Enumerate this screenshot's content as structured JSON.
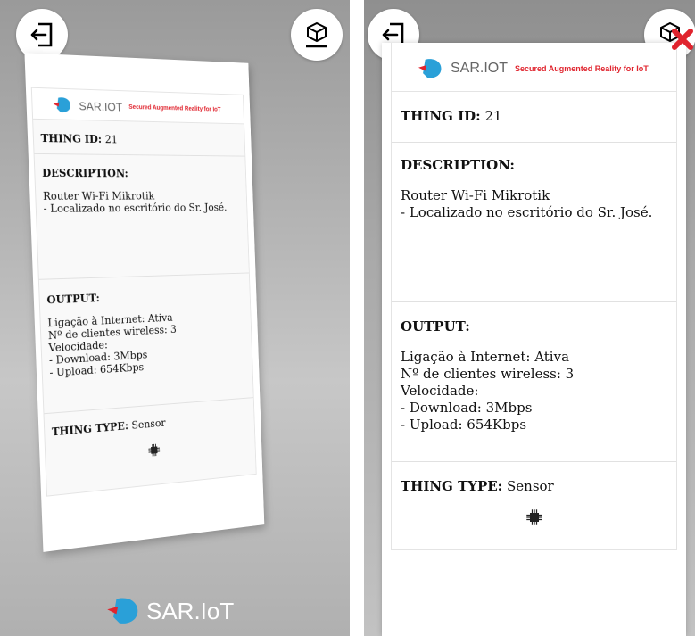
{
  "brand": {
    "name": "SAR.IOT",
    "tagline": "Secured Augmented Reality for IoT",
    "bottom_name": "SAR.IoT",
    "accent": "#e0242e"
  },
  "card": {
    "thing_id_label": "THING ID:",
    "thing_id_value": "21",
    "description_label": "DESCRIPTION:",
    "description_lines": [
      "Router Wi-Fi Mikrotik",
      "- Localizado no escritório do Sr. José."
    ],
    "output_label": "OUTPUT:",
    "output_lines": [
      "Ligação à Internet: Ativa",
      "Nº de clientes wireless: 3",
      "Velocidade:",
      "- Download: 3Mbps",
      "- Upload: 654Kbps"
    ],
    "thing_type_label": "THING TYPE:",
    "thing_type_value": "Sensor"
  },
  "icons": {
    "exit": "exit-icon",
    "ar_cube": "ar-cube-icon",
    "close": "close-icon",
    "chip": "chip-icon",
    "logo": "sar-iot-logo"
  }
}
